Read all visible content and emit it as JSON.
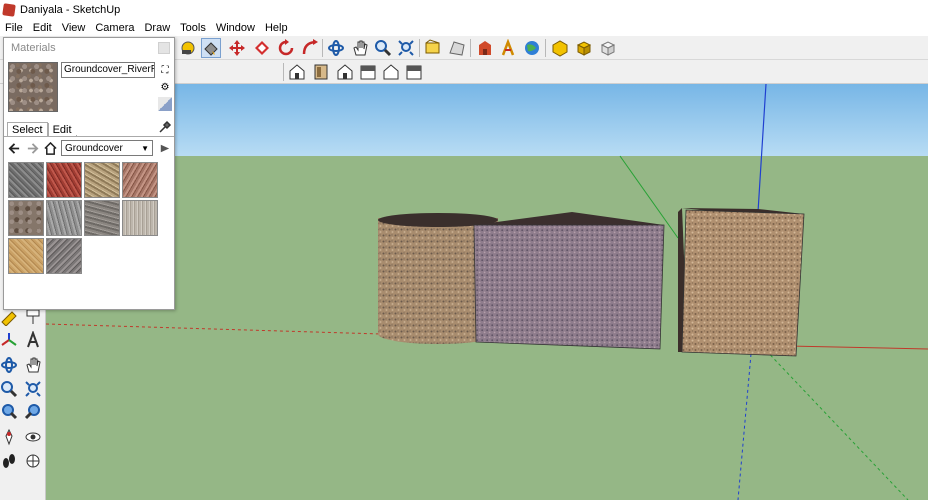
{
  "window": {
    "title": "Daniyala - SketchUp"
  },
  "menu": [
    "File",
    "Edit",
    "View",
    "Camera",
    "Draw",
    "Tools",
    "Window",
    "Help"
  ],
  "materials_panel": {
    "title": "Materials",
    "current_material": "Groundcover_RiverRock",
    "tabs": [
      "Select",
      "Edit"
    ],
    "active_tab": "Select",
    "collection": "Groundcover",
    "swatches": [
      "gravel-grey",
      "gravel-red",
      "gravel-tan",
      "gravel-pink",
      "river-rock",
      "gravel-grey-fine",
      "gravel-mixed",
      "stone-light",
      "sand",
      "gravel-dark"
    ]
  },
  "toolbar_icons": [
    "paint-bucket-icon",
    "eraser-icon",
    "move-icon",
    "rotate-icon",
    "follow-me-icon",
    "orbit-icon",
    "pan-icon",
    "zoom-icon",
    "zoom-extents-icon"
  ],
  "colors": {
    "sky_top": "#77b6e6",
    "ground": "#95b786",
    "axis_red": "#c0392b",
    "axis_green": "#27a135",
    "axis_blue": "#1f3fd0"
  }
}
